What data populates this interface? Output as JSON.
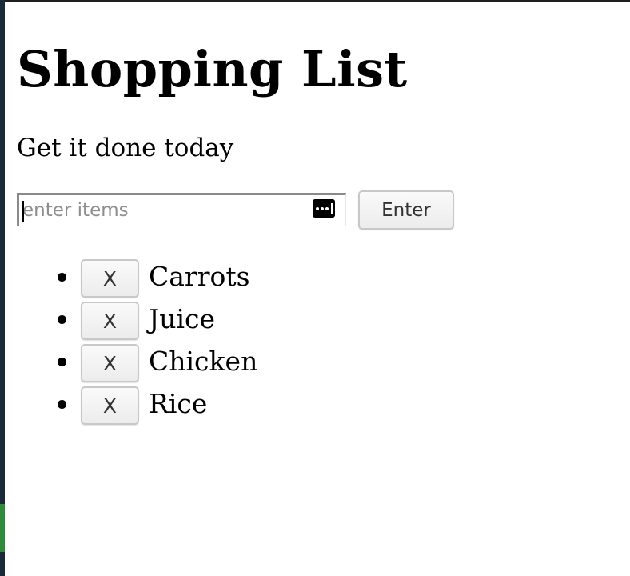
{
  "page": {
    "title": "Shopping List",
    "subtitle": "Get it done today"
  },
  "form": {
    "input_placeholder": "enter items",
    "input_value": "",
    "password_manager_icon": "password-dots-icon",
    "enter_label": "Enter"
  },
  "list": {
    "remove_label": "X",
    "items": [
      {
        "label": "Carrots"
      },
      {
        "label": "Juice"
      },
      {
        "label": "Chicken"
      },
      {
        "label": "Rice"
      }
    ]
  }
}
